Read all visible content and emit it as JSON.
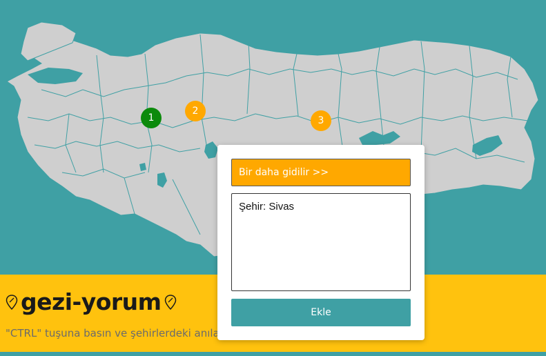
{
  "map": {
    "markers": [
      {
        "label": "1",
        "color": "#0c8a0c"
      },
      {
        "label": "2",
        "color": "#ffa800"
      },
      {
        "label": "3",
        "color": "#ffa800"
      }
    ],
    "land_color": "#cfcfcf",
    "sea_color": "#3fa0a4"
  },
  "footer": {
    "title": "gezi-yorum",
    "hint": "\"CTRL\" tuşuna basın ve şehirlerdeki anıla",
    "hint_tail": "...",
    "background": "#ffc20e"
  },
  "modal": {
    "again_button_label": "Bir daha gidilir >>",
    "comment_text": "Şehir: Sivas",
    "add_button_label": "Ekle"
  },
  "colors": {
    "accent": "#ffa800",
    "teal": "#3fa0a4",
    "visited": "#0c8a0c"
  }
}
